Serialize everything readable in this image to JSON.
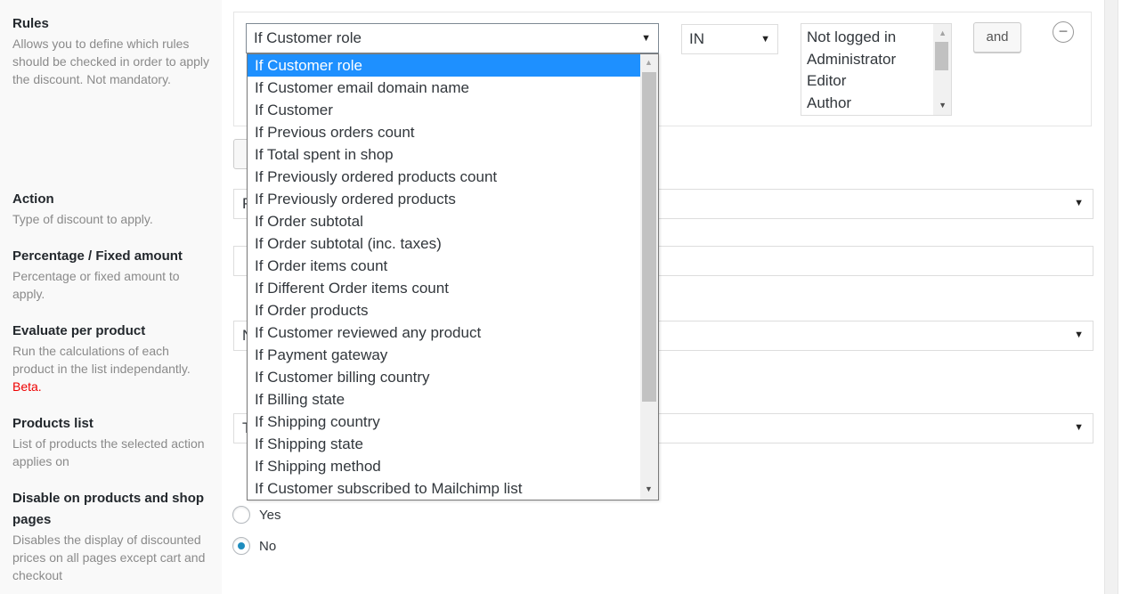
{
  "fields": {
    "rules": {
      "title": "Rules",
      "desc": "Allows you to define which rules should be checked in order to apply the discount. Not mandatory."
    },
    "action": {
      "title": "Action",
      "desc": "Type of discount to apply."
    },
    "amount": {
      "title": "Percentage / Fixed amount",
      "desc": "Percentage or fixed amount to apply."
    },
    "evaluate": {
      "title": "Evaluate per product",
      "desc": "Run the calculations of each product in the list independantly.",
      "beta": "Beta."
    },
    "products": {
      "title": "Products list",
      "desc": "List of products the selected action applies on"
    },
    "disable": {
      "title": "Disable on products and shop pages",
      "desc": "Disables the display of discounted prices on all pages except cart and checkout"
    }
  },
  "rule": {
    "condition_value": "If Customer role",
    "operator_value": "IN",
    "roles": [
      "Not logged in",
      "Administrator",
      "Editor",
      "Author"
    ],
    "and_label": "and",
    "remove_label": "−"
  },
  "peek": {
    "action": "P",
    "evaluate": "N",
    "products": "T"
  },
  "dropdown": {
    "options": [
      "If Customer role",
      "If Customer email domain name",
      "If Customer",
      "If Previous orders count",
      "If Total spent in shop",
      "If Previously ordered products count",
      "If Previously ordered products",
      "If Order subtotal",
      "If Order subtotal (inc. taxes)",
      "If Order items count",
      "If Different Order items count",
      "If Order products",
      "If Customer reviewed any product",
      "If Payment gateway",
      "If Customer billing country",
      "If Billing state",
      "If Shipping country",
      "If Shipping state",
      "If Shipping method",
      "If Customer subscribed to Mailchimp list"
    ],
    "selected_index": 0
  },
  "disable_radio": {
    "yes": "Yes",
    "no": "No",
    "checked": "No"
  },
  "colors": {
    "accent": "#1e90ff",
    "radio_dot": "#1e8cbe",
    "beta": "#ee0000"
  }
}
